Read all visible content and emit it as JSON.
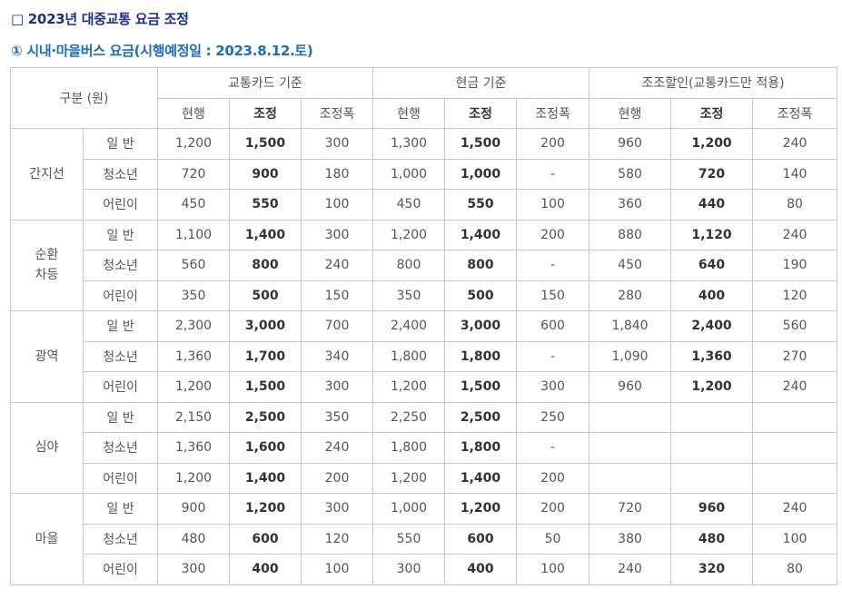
{
  "title": "□ 2023년 대중교통 요금 조정",
  "subtitle": "① 시내·마을버스 요금(시행예정일 : 2023.8.12.토)",
  "table": {
    "header": {
      "category": "구분 (원)",
      "groups": [
        "교통카드 기준",
        "현금 기준",
        "조조할인(교통카드만 적용)"
      ],
      "sub": [
        "현행",
        "조정",
        "조정폭",
        "현행",
        "조정",
        "조정폭",
        "현행",
        "조정",
        "조정폭"
      ]
    },
    "groups": [
      {
        "name": [
          "간지선"
        ],
        "rows": [
          {
            "type": "일 반",
            "cells": [
              "1,200",
              "1,500",
              "300",
              "1,300",
              "1,500",
              "200",
              "960",
              "1,200",
              "240"
            ]
          },
          {
            "type": "청소년",
            "cells": [
              "720",
              "900",
              "180",
              "1,000",
              "1,000",
              "-",
              "580",
              "720",
              "140"
            ]
          },
          {
            "type": "어린이",
            "cells": [
              "450",
              "550",
              "100",
              "450",
              "550",
              "100",
              "360",
              "440",
              "80"
            ]
          }
        ]
      },
      {
        "name": [
          "순환",
          "차등"
        ],
        "rows": [
          {
            "type": "일 반",
            "cells": [
              "1,100",
              "1,400",
              "300",
              "1,200",
              "1,400",
              "200",
              "880",
              "1,120",
              "240"
            ]
          },
          {
            "type": "청소년",
            "cells": [
              "560",
              "800",
              "240",
              "800",
              "800",
              "-",
              "450",
              "640",
              "190"
            ]
          },
          {
            "type": "어린이",
            "cells": [
              "350",
              "500",
              "150",
              "350",
              "500",
              "150",
              "280",
              "400",
              "120"
            ]
          }
        ]
      },
      {
        "name": [
          "광역"
        ],
        "rows": [
          {
            "type": "일 반",
            "cells": [
              "2,300",
              "3,000",
              "700",
              "2,400",
              "3,000",
              "600",
              "1,840",
              "2,400",
              "560"
            ]
          },
          {
            "type": "청소년",
            "cells": [
              "1,360",
              "1,700",
              "340",
              "1,800",
              "1,800",
              "-",
              "1,090",
              "1,360",
              "270"
            ]
          },
          {
            "type": "어린이",
            "cells": [
              "1,200",
              "1,500",
              "300",
              "1,200",
              "1,500",
              "300",
              "960",
              "1,200",
              "240"
            ]
          }
        ]
      },
      {
        "name": [
          "심야"
        ],
        "rows": [
          {
            "type": "일 반",
            "cells": [
              "2,150",
              "2,500",
              "350",
              "2,250",
              "2,500",
              "250",
              "",
              "",
              ""
            ]
          },
          {
            "type": "청소년",
            "cells": [
              "1,360",
              "1,600",
              "240",
              "1,800",
              "1,800",
              "-",
              "",
              "",
              ""
            ]
          },
          {
            "type": "어린이",
            "cells": [
              "1,200",
              "1,400",
              "200",
              "1,200",
              "1,400",
              "200",
              "",
              "",
              ""
            ]
          }
        ]
      },
      {
        "name": [
          "마을"
        ],
        "rows": [
          {
            "type": "일 반",
            "cells": [
              "900",
              "1,200",
              "300",
              "1,000",
              "1,200",
              "200",
              "720",
              "960",
              "240"
            ]
          },
          {
            "type": "청소년",
            "cells": [
              "480",
              "600",
              "120",
              "550",
              "600",
              "50",
              "380",
              "480",
              "100"
            ]
          },
          {
            "type": "어린이",
            "cells": [
              "300",
              "400",
              "100",
              "300",
              "400",
              "100",
              "240",
              "320",
              "80"
            ]
          }
        ]
      }
    ]
  }
}
